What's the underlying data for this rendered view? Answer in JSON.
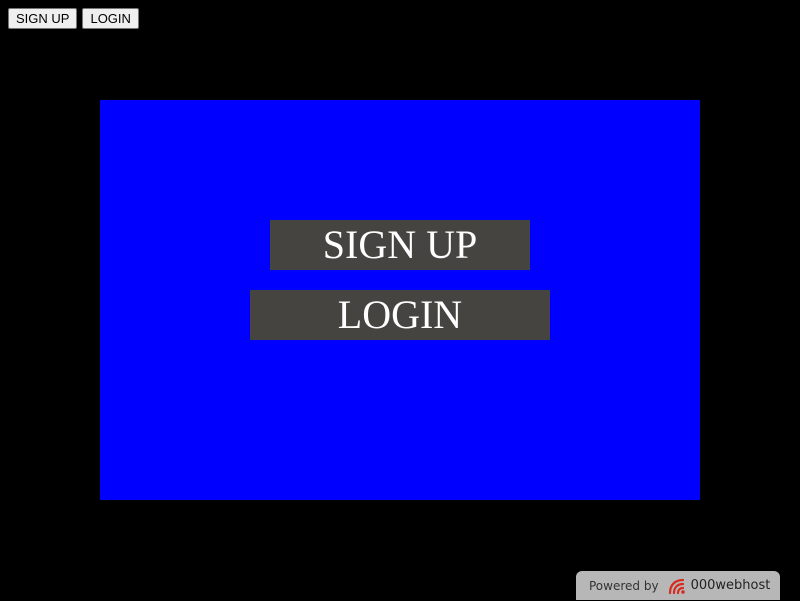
{
  "top_nav": {
    "signup_label": "SIGN UP",
    "login_label": "LOGIN"
  },
  "panel": {
    "signup_label": "SIGN UP",
    "login_label": "LOGIN",
    "background_color": "#0000ff",
    "button_color": "#454440"
  },
  "footer": {
    "powered_by": "Powered by",
    "host_name": "000webhost",
    "logo_icon": "000webhost-logo"
  }
}
